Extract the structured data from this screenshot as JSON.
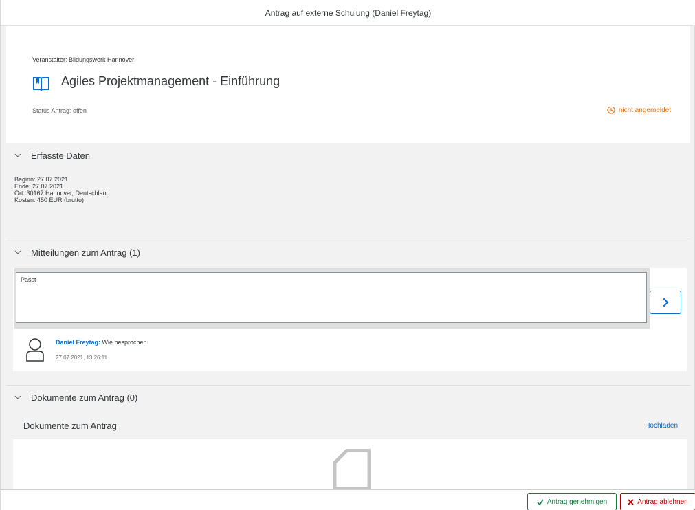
{
  "window": {
    "title": "Antrag auf externe Schulung (Daniel Freytag)"
  },
  "header": {
    "organizer": "Veranstalter: Bildungswerk Hannover",
    "course_title": "Agiles Projektmanagement - Einführung",
    "status_label": "Status Antrag: offen",
    "status_badge": "nicht angemeldet",
    "status_color": "#e9730c"
  },
  "sections": {
    "data": {
      "title": "Erfasste Daten",
      "lines": [
        "Beginn: 27.07.2021",
        "Ende: 27.07.2021",
        "Ort: 30167 Hannover, Deutschland",
        "Kosten: 450 EUR (brutto)"
      ]
    },
    "messages": {
      "title": "Mitteilungen zum Antrag (1)",
      "input_value": "Passt",
      "feed": [
        {
          "author": "Daniel Freytag:",
          "text": " Wie besprochen",
          "timestamp": "27.07.2021, 13:26:11"
        }
      ]
    },
    "documents": {
      "title": "Dokumente zum Antrag (0)",
      "list_title": "Dokumente zum Antrag",
      "upload_label": "Hochladen"
    }
  },
  "footer": {
    "approve_label": "Antrag genehmigen",
    "reject_label": "Antrag ablehnen",
    "approve_color": "#107e3e",
    "reject_color": "#bb0000"
  },
  "icons": [
    "book-icon",
    "clock-icon",
    "chevron-down-icon",
    "chevron-right-icon",
    "person-icon",
    "document-icon",
    "check-icon",
    "cross-icon"
  ]
}
